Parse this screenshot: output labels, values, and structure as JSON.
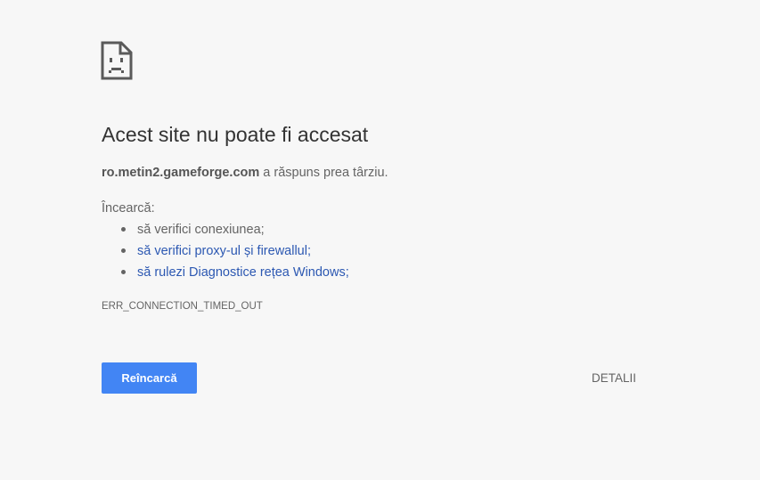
{
  "error_icon": "sad-document-icon",
  "headline": "Acest site nu poate fi accesat",
  "summary": {
    "host": "ro.metin2.gameforge.com",
    "message": "a răspuns prea târziu."
  },
  "suggestions": {
    "label": "Încearcă:",
    "items": [
      {
        "text": "să verifici conexiunea;",
        "is_link": false
      },
      {
        "text": "să verifici proxy-ul și firewallul;",
        "is_link": true
      },
      {
        "text": "să rulezi Diagnostice rețea Windows;",
        "is_link": true
      }
    ]
  },
  "error_code": "ERR_CONNECTION_TIMED_OUT",
  "buttons": {
    "reload_label": "Reîncarcă",
    "details_label": "DETALII"
  },
  "colors": {
    "background": "#f7f7f7",
    "primary_button": "#4285f4",
    "link": "#2c58b2",
    "heading": "#333333",
    "body_text": "#646464"
  }
}
